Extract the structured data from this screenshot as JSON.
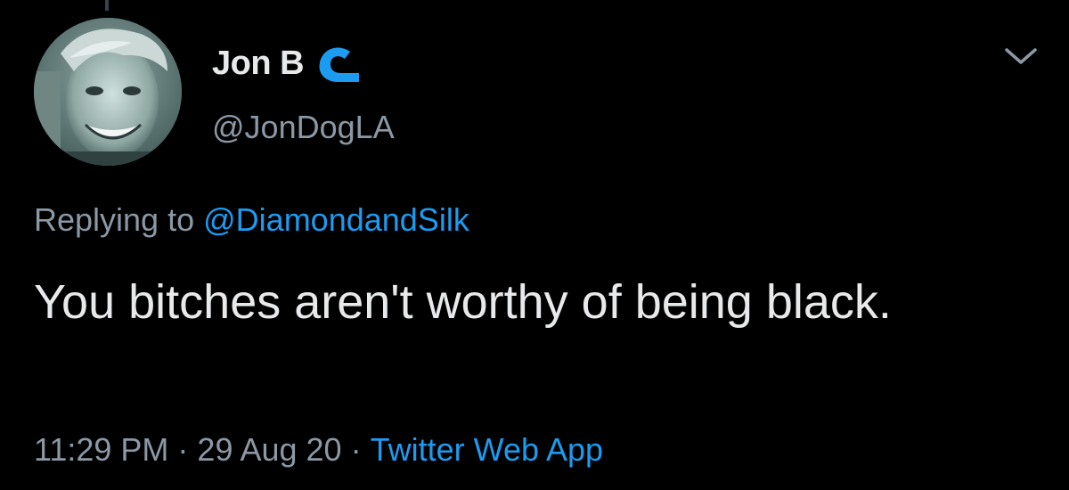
{
  "tweet": {
    "display_name": "Jon B",
    "handle": "@JonDogLA",
    "badge_icon": "wave-icon",
    "menu_icon": "chevron-down-icon",
    "replying_prefix": "Replying to",
    "replying_to": "@DiamondandSilk",
    "text": "You bitches aren't worthy of being black.",
    "time": "11:29 PM",
    "date": "29 Aug 20",
    "separator": "·",
    "source": "Twitter Web App"
  },
  "colors": {
    "background": "#000000",
    "primary_text": "#e7e9ea",
    "secondary_text": "#8b98a5",
    "link": "#1d9bf0"
  }
}
